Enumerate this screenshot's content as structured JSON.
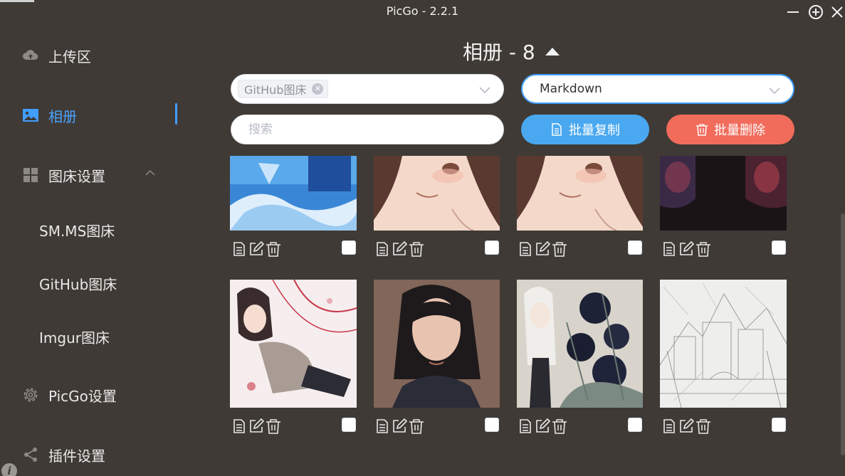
{
  "window": {
    "title": "PicGo - 2.2.1",
    "controls": [
      "minimize-icon",
      "maximize-icon",
      "close-icon"
    ]
  },
  "sidebar": {
    "items": [
      {
        "label": "上传区",
        "icon": "cloud-upload-icon"
      },
      {
        "label": "相册",
        "icon": "image-icon",
        "active": true
      },
      {
        "label": "图床设置",
        "icon": "grid-icon",
        "expanded": true
      },
      {
        "label": "PicGo设置",
        "icon": "gear-icon"
      },
      {
        "label": "插件设置",
        "icon": "share-icon"
      }
    ],
    "sub_items": [
      {
        "label": "SM.MS图床"
      },
      {
        "label": "GitHub图床"
      },
      {
        "label": "Imgur图床"
      }
    ]
  },
  "gallery": {
    "title": "相册 - 8",
    "filter_tag": "GitHub图床",
    "format_value": "Markdown",
    "search_placeholder": "搜索",
    "copy_button": "批量复制",
    "delete_button": "批量删除"
  },
  "colors": {
    "background": "#3f3a35",
    "accent": "#409eff",
    "copy_button": "#49a8ef",
    "delete_button": "#f26c5c"
  },
  "images": [
    {
      "name": "blue-fantasy-art"
    },
    {
      "name": "anime-girl-closeup-1"
    },
    {
      "name": "anime-girl-closeup-2"
    },
    {
      "name": "dark-anime-characters"
    },
    {
      "name": "anime-girl-reclining"
    },
    {
      "name": "woman-portrait-photo"
    },
    {
      "name": "anime-girl-flowers"
    },
    {
      "name": "pencil-sketch-city"
    }
  ]
}
